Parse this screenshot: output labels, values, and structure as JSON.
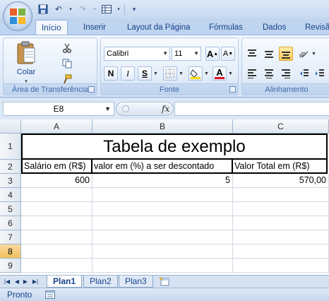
{
  "ribbon": {
    "tabs": [
      "Início",
      "Inserir",
      "Layout da Página",
      "Fórmulas",
      "Dados",
      "Revisã"
    ],
    "clipboard": {
      "paste_label": "Colar",
      "group_label": "Área de Transferência"
    },
    "font": {
      "family": "Calibri",
      "size": "11",
      "bold": "N",
      "italic": "I",
      "underline": "S",
      "group_label": "Fonte"
    },
    "alignment": {
      "group_label": "Alinhamento"
    }
  },
  "formula_bar": {
    "name_box": "E8",
    "fx": "fx",
    "formula": ""
  },
  "sheet": {
    "columns": [
      "A",
      "B",
      "C"
    ],
    "rows": [
      "1",
      "2",
      "3",
      "4",
      "5",
      "6",
      "7",
      "8",
      "9"
    ],
    "selected_row": "8",
    "title": "Tabela de exemplo",
    "headers": [
      "Salário em (R$)",
      "valor em (%) a ser descontado",
      "Valor Total em (R$)"
    ],
    "row3": [
      "600",
      "5",
      "570,00"
    ]
  },
  "sheet_tabs": [
    "Plan1",
    "Plan2",
    "Plan3"
  ],
  "status": {
    "text": "Pronto"
  },
  "colors": {
    "accent": "#15428b",
    "selection": "#f1c15f",
    "ribbon": "#dbe8f7"
  }
}
